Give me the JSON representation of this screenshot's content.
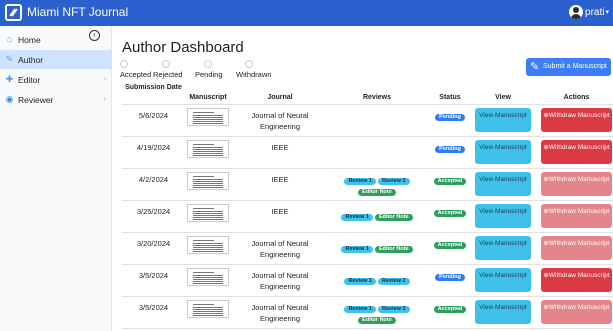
{
  "app": {
    "title": "Miami NFT Journal",
    "user": "prati"
  },
  "sidebar": {
    "items": [
      {
        "label": "Home",
        "icon": "home-icon",
        "active": false,
        "chevron": false
      },
      {
        "label": "Author",
        "icon": "edit-icon",
        "active": true,
        "chevron": false
      },
      {
        "label": "Editor",
        "icon": "editor-icon",
        "active": false,
        "chevron": true
      },
      {
        "label": "Reviewer",
        "icon": "reviewer-icon",
        "active": false,
        "chevron": true
      }
    ]
  },
  "main": {
    "title": "Author Dashboard",
    "submit_label": "Submit a Manuscript",
    "filters": [
      "Accepted",
      "Rejected",
      "Pending",
      "Withdrawn"
    ],
    "columns": [
      "Submission Date",
      "Manuscript",
      "Journal",
      "Reviews",
      "Status",
      "View",
      "Actions"
    ],
    "rows": [
      {
        "date": "5/6/2024",
        "journal": "Journal of Neural Engineering",
        "reviews": [],
        "note": false,
        "status": "Pending",
        "view": "View Manuscript",
        "action": "Withdraw Manuscript",
        "action_enabled": true
      },
      {
        "date": "4/19/2024",
        "journal": "IEEE",
        "reviews": [],
        "note": false,
        "status": "Pending",
        "view": "View Manuscript",
        "action": "Withdraw Manuscript",
        "action_enabled": true
      },
      {
        "date": "4/2/2024",
        "journal": "IEEE",
        "reviews": [
          "Review 1",
          "Review 2"
        ],
        "note": true,
        "status": "Accepted",
        "view": "View Manuscript",
        "action": "Withdraw Manuscript",
        "action_enabled": false
      },
      {
        "date": "3/25/2024",
        "journal": "IEEE",
        "reviews": [
          "Review 1"
        ],
        "note": true,
        "status": "Accepted",
        "view": "View Manuscript",
        "action": "Withdraw Manuscript",
        "action_enabled": false
      },
      {
        "date": "3/20/2024",
        "journal": "Journal of Neural Engineering",
        "reviews": [
          "Review 1"
        ],
        "note": true,
        "status": "Accepted",
        "view": "View Manuscript",
        "action": "Withdraw Manuscript",
        "action_enabled": false
      },
      {
        "date": "3/5/2024",
        "journal": "Journal of Neural Engineering",
        "reviews": [
          "Review 1",
          "Review 2"
        ],
        "note": false,
        "status": "Pending",
        "view": "View Manuscript",
        "action": "Withdraw Manuscript",
        "action_enabled": true
      },
      {
        "date": "3/5/2024",
        "journal": "Journal of Neural Engineering",
        "reviews": [
          "Review 1",
          "Review 2"
        ],
        "note": true,
        "status": "Accepted",
        "view": "View Manuscript",
        "action": "Withdraw Manuscript",
        "action_enabled": false
      }
    ],
    "note_label": "Editor Note"
  },
  "colors": {
    "topbar": "#2b60cf",
    "accent": "#3d7df5",
    "view_button": "#3fc1ea",
    "withdraw_active": "#db3944",
    "withdraw_disabled": "#e4858b",
    "accepted": "#2f9e5f",
    "pending": "#2f7cf6"
  }
}
